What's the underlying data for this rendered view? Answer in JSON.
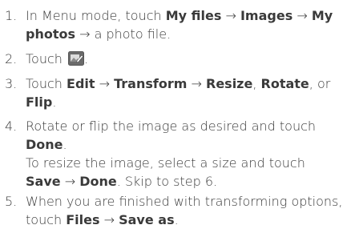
{
  "steps": [
    {
      "number": "1.",
      "line1_prefix": "In Menu mode, touch ",
      "line1_b1": "My files",
      "arrow": "→",
      "line1_b2": "Images",
      "line1_b3": "My",
      "line2_b1": "photos",
      "line2_suffix": " → a photo file."
    },
    {
      "number": "2.",
      "text": "Touch ",
      "icon": "edit-photo-icon",
      "end": "."
    },
    {
      "number": "3.",
      "prefix": "Touch ",
      "b1": "Edit",
      "b2": "Transform",
      "b3": "Resize",
      "sep1": ", ",
      "b4": "Rotate",
      "sep2": ", or",
      "b5": "Flip",
      "end": "."
    },
    {
      "number": "4.",
      "line1": "Rotate or flip the image as desired and touch",
      "b1": "Done",
      "end": ".",
      "sub_line1": "To resize the image, select a size and touch",
      "sub_b1": "Save",
      "sub_b2": "Done",
      "sub_suffix": ". Skip to step 6."
    },
    {
      "number": "5.",
      "line1": "When you are finished with transforming options,",
      "prefix2": "touch ",
      "b1": "Files",
      "b2": "Save as",
      "end": "."
    }
  ]
}
